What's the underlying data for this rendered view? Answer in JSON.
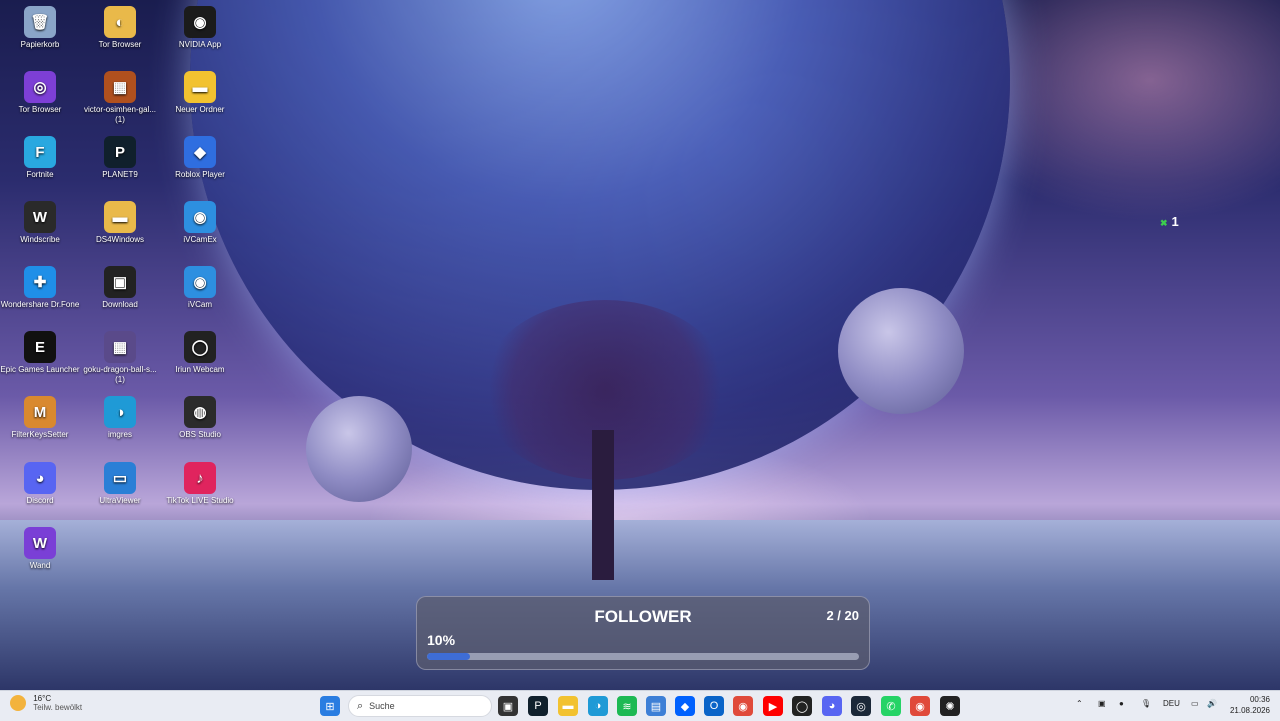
{
  "desktop": {
    "icons": [
      {
        "label": "Papierkorb",
        "icon": "recycle-bin-icon",
        "color": "#8aa5c8",
        "glyph": "🗑"
      },
      {
        "label": "Tor Browser",
        "icon": "tor-folder-icon",
        "color": "#e9b94a",
        "glyph": "◐"
      },
      {
        "label": "NVIDIA App",
        "icon": "nvidia-icon",
        "color": "#1b1b1b",
        "glyph": "◉"
      },
      {
        "label": "Tor Browser",
        "icon": "tor-browser-icon",
        "color": "#7d3fd6",
        "glyph": "◎"
      },
      {
        "label": "victor-osimhen-gal...",
        "label2": "(1)",
        "icon": "image-file-icon",
        "color": "#b0501e",
        "glyph": "▦"
      },
      {
        "label": "Neuer Ordner",
        "icon": "folder-icon",
        "color": "#f2c230",
        "glyph": "▬"
      },
      {
        "label": "Fortnite",
        "icon": "fortnite-icon",
        "color": "#29a8e0",
        "glyph": "F"
      },
      {
        "label": "PLANET9",
        "icon": "planet9-icon",
        "color": "#10202c",
        "glyph": "P"
      },
      {
        "label": "Roblox Player",
        "icon": "roblox-icon",
        "color": "#2f6ee0",
        "glyph": "◆"
      },
      {
        "label": "Windscribe",
        "icon": "windscribe-icon",
        "color": "#2a2a2a",
        "glyph": "W"
      },
      {
        "label": "DS4Windows",
        "icon": "ds4windows-folder-icon",
        "color": "#e9b94a",
        "glyph": "▬"
      },
      {
        "label": "iVCamEx",
        "icon": "ivcam-icon",
        "color": "#2d8fe0",
        "glyph": "◉"
      },
      {
        "label": "Wondershare Dr.Fone",
        "icon": "drfone-icon",
        "color": "#1f8fe8",
        "glyph": "✚"
      },
      {
        "label": "Download",
        "icon": "download-icon",
        "color": "#222",
        "glyph": "▣"
      },
      {
        "label": "iVCam",
        "icon": "ivcam-icon",
        "color": "#2d8fe0",
        "glyph": "◉"
      },
      {
        "label": "Epic Games Launcher",
        "icon": "epic-games-icon",
        "color": "#111",
        "glyph": "E"
      },
      {
        "label": "goku-dragon-ball-s...",
        "label2": "(1)",
        "icon": "image-file-icon",
        "color": "#5a4a8a",
        "glyph": "▦"
      },
      {
        "label": "Iriun Webcam",
        "icon": "iriun-icon",
        "color": "#222",
        "glyph": "◯"
      },
      {
        "label": "FilterKeysSetter",
        "icon": "filterkeys-icon",
        "color": "#d9892f",
        "glyph": "M"
      },
      {
        "label": "imgres",
        "icon": "edge-image-icon",
        "color": "#1f9ad6",
        "glyph": "◑"
      },
      {
        "label": "OBS Studio",
        "icon": "obs-icon",
        "color": "#2b2b2b",
        "glyph": "◍"
      },
      {
        "label": "Discord",
        "icon": "discord-icon",
        "color": "#5865f2",
        "glyph": "◕"
      },
      {
        "label": "UltraViewer",
        "icon": "ultraviewer-icon",
        "color": "#2a7fd6",
        "glyph": "▭"
      },
      {
        "label": "TikTok LIVE Studio",
        "icon": "tiktok-live-icon",
        "color": "#e0245e",
        "glyph": "♪"
      },
      {
        "label": "Wand",
        "icon": "wand-icon",
        "color": "#7a3fd6",
        "glyph": "W"
      }
    ]
  },
  "badge": {
    "mark": "✖",
    "value": "1"
  },
  "follower_widget": {
    "title": "FOLLOWER",
    "count": "2 / 20",
    "percent_label": "10%",
    "progress": 0.1
  },
  "taskbar": {
    "weather_temp": "16°C",
    "weather_desc": "Teilw. bewölkt",
    "search_placeholder": "Suche",
    "lang": "DEU",
    "time": "00:36",
    "date": "21.08.2026",
    "apps": [
      {
        "name": "start-icon",
        "color": "#2a7de1",
        "glyph": "⊞"
      },
      {
        "name": "task-view-icon",
        "color": "#333",
        "glyph": "▣"
      },
      {
        "name": "planet9-taskbar-icon",
        "color": "#10202c",
        "glyph": "P"
      },
      {
        "name": "explorer-icon",
        "color": "#f2c230",
        "glyph": "▬"
      },
      {
        "name": "edge-icon",
        "color": "#1f9ad6",
        "glyph": "◑"
      },
      {
        "name": "spotify-icon",
        "color": "#1db954",
        "glyph": "≋"
      },
      {
        "name": "store-icon",
        "color": "#3d7fd6",
        "glyph": "▤"
      },
      {
        "name": "dropbox-icon",
        "color": "#0061fe",
        "glyph": "◆"
      },
      {
        "name": "outlook-icon",
        "color": "#0a64c8",
        "glyph": "O"
      },
      {
        "name": "chrome-icon",
        "color": "#e04a3a",
        "glyph": "◉"
      },
      {
        "name": "youtube-icon",
        "color": "#ff0000",
        "glyph": "▶"
      },
      {
        "name": "iriun-taskbar-icon",
        "color": "#222",
        "glyph": "◯"
      },
      {
        "name": "discord-taskbar-icon",
        "color": "#5865f2",
        "glyph": "◕"
      },
      {
        "name": "steam-icon",
        "color": "#1b2838",
        "glyph": "◎"
      },
      {
        "name": "whatsapp-icon",
        "color": "#25d366",
        "glyph": "✆"
      },
      {
        "name": "chrome-2-icon",
        "color": "#e04a3a",
        "glyph": "◉"
      },
      {
        "name": "chatgpt-icon",
        "color": "#222",
        "glyph": "✺"
      }
    ]
  }
}
